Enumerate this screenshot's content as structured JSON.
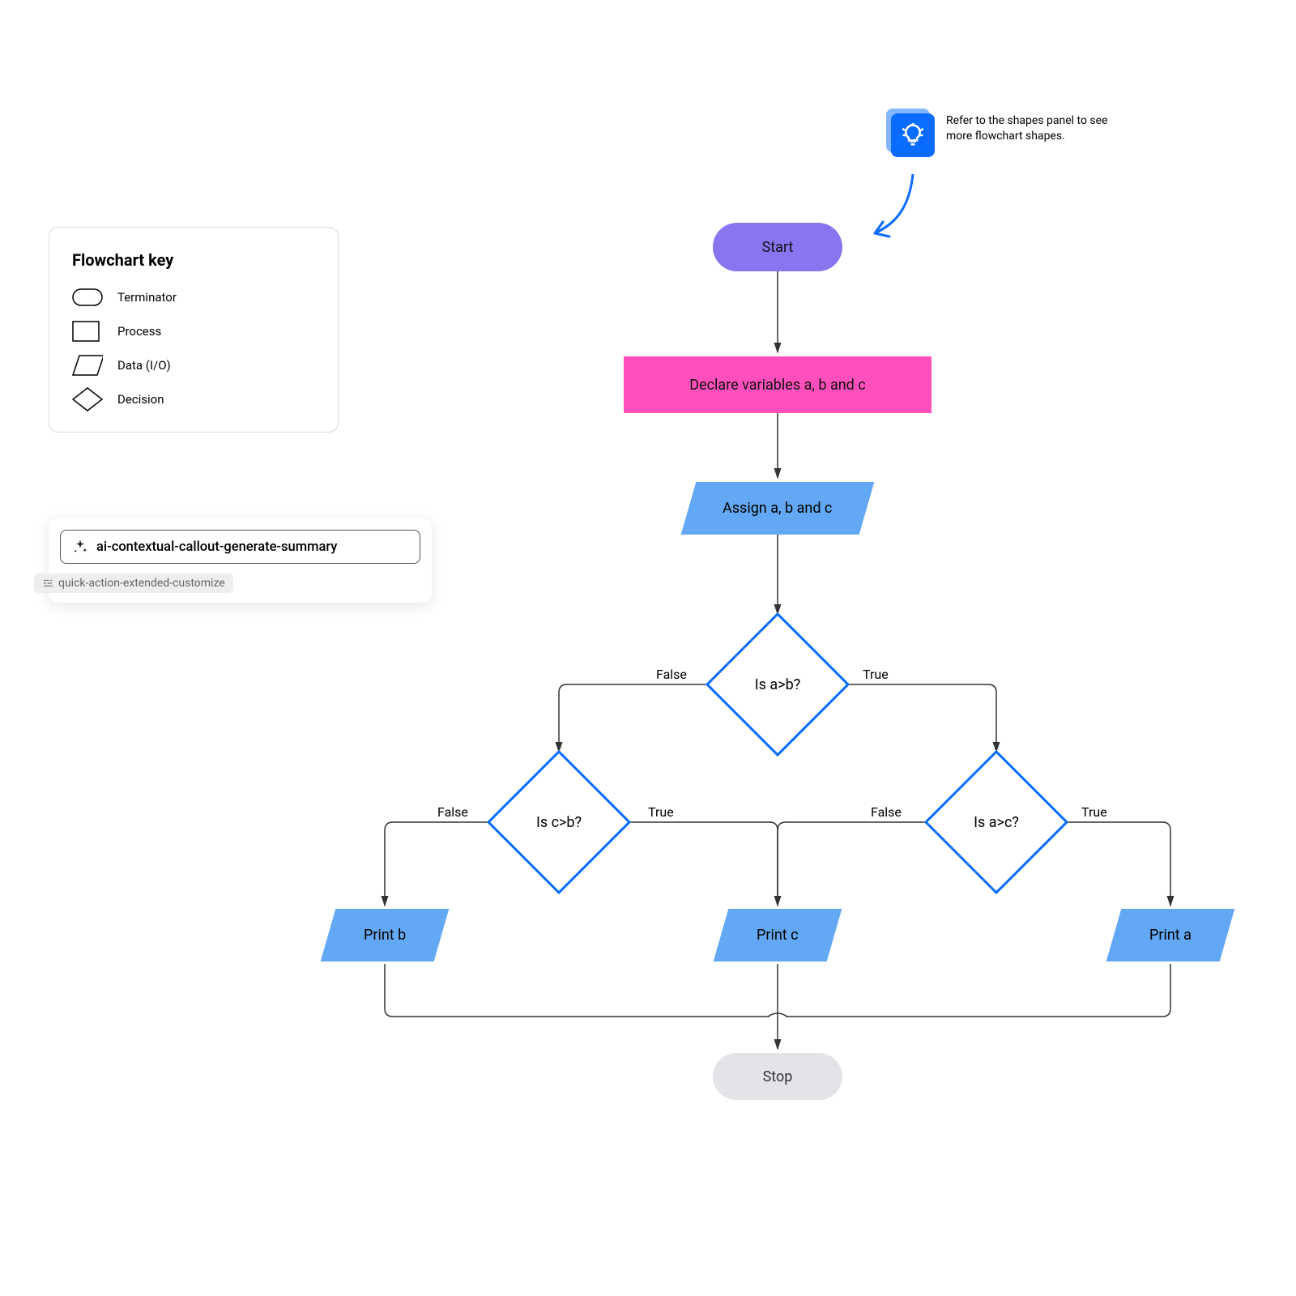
{
  "tip": {
    "text": "Refer to the shapes panel to see more flowchart shapes."
  },
  "key": {
    "title": "Flowchart key",
    "items": [
      {
        "label": "Terminator"
      },
      {
        "label": "Process"
      },
      {
        "label": "Data (I/O)"
      },
      {
        "label": "Decision"
      }
    ]
  },
  "callout": {
    "primary": "ai-contextual-callout-generate-summary",
    "secondary": "quick-action-extended-customize"
  },
  "flow": {
    "start": "Start",
    "declare": "Declare variables a, b and c",
    "assign": "Assign a, b and c",
    "d1": "Is a>b?",
    "d2": "Is c>b?",
    "d3": "Is a>c?",
    "pb": "Print b",
    "pc": "Print c",
    "pa": "Print a",
    "stop": "Stop",
    "trueLabel": "True",
    "falseLabel": "False"
  },
  "colors": {
    "start": "#8a74f0",
    "process": "#ff4fbc",
    "data": "#62a8f4",
    "decisionStroke": "#0a6cff",
    "stop": "#e2e4e8",
    "connector": "#333"
  }
}
